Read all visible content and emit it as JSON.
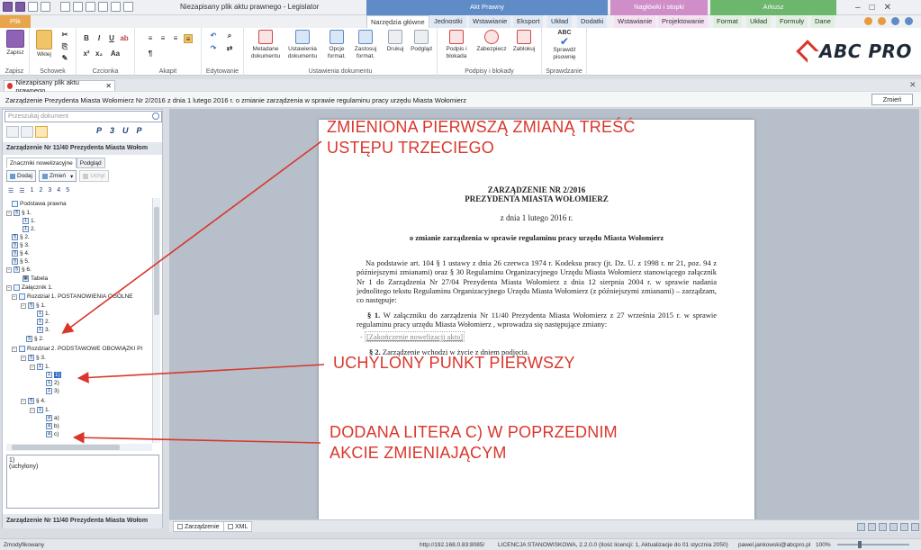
{
  "window": {
    "title": "Niezapisany plik aktu prawnego - Legislator"
  },
  "context_tabs": {
    "akt": "Akt Prawny",
    "naglowki": "Nagłówki i stopki",
    "arkusz": "Arkusz"
  },
  "tabs": {
    "plik": "Plik",
    "narzedzia": "Narzędzia główne",
    "jednostki": "Jednostki",
    "wstawianie": "Wstawianie",
    "eksport": "Eksport",
    "uklad": "Układ",
    "dodatki": "Dodatki",
    "hf_wstawianie": "Wstawianie",
    "projektowanie": "Projektowanie",
    "format": "Format",
    "ark_uklad": "Układ",
    "formuly": "Formuły",
    "dane": "Dane"
  },
  "ribbon": {
    "zapisz": "Zapisz",
    "wklej": "Wklej",
    "metadane": "Metadane dokumentu",
    "ustawienia": "Ustawienia dokumentu",
    "opcje": "Opcje format.",
    "zastosuj": "Zastosuj format.",
    "drukuj": "Drukuj",
    "podglad": "Podgląd",
    "podpis": "Podpis i blokada",
    "zabezpiecz": "Zabezpiecz",
    "zablokuj": "Zablokuj",
    "sprawdz": "Sprawdź pisownię",
    "abc": "ABC",
    "groups": {
      "zapisz": "Zapisz",
      "schowek": "Schowek",
      "czcionka": "Czcionka",
      "akapit": "Akapit",
      "edytowanie": "Edytowanie",
      "ustawienia": "Ustawienia dokumentu",
      "podpisy": "Podpisy i blokady",
      "sprawdzanie": "Sprawdzanie"
    }
  },
  "logo": {
    "text": "ABC PRO"
  },
  "doc_tab": {
    "label": "Niezapisany plik aktu prawnego"
  },
  "subtitle": {
    "text": "Zarządzenie Prezydenta Miasta Wołomierz Nr 2/2016 z dnia 1 lutego 2016 r. o zmianie zarządzenia w sprawie regulaminu pracy urzędu Miasta Wołomierz",
    "button": "Zmień"
  },
  "left": {
    "search_placeholder": "Przeszukaj dokument",
    "heading": "Zarządzenie Nr 11/40 Prezydenta Miasta Wołom",
    "tab_znaczniki": "Znaczniki nowelizacyjne",
    "tab_podglad": "Podgląd",
    "btn_dodaj": "Dodaj",
    "btn_zmien": "Zmień",
    "btn_uchyl": "Uchyl",
    "levels": [
      "1",
      "2",
      "3",
      "4",
      "5"
    ],
    "tree": [
      "Podstawa prawna",
      "§ 1.",
      "1.",
      "2.",
      "§ 2.",
      "§ 3.",
      "§ 4.",
      "§ 5.",
      "§ 6.",
      "Tabela",
      "Załącznik 1.",
      "Rozdział 1. POSTANOWIENIA OGÓLNE",
      "§ 1.",
      "1.",
      "2.",
      "3.",
      "§ 2.",
      "Rozdział 2. PODSTAWOWE OBOWIĄZKI PI",
      "§ 3.",
      "1.",
      "1)",
      "2)",
      "3)",
      "§ 4.",
      "1.",
      "a)",
      "b)",
      "c)"
    ],
    "detail_line1": "1)",
    "detail_line2": "(uchylony)",
    "footer": "Zarządzenie Nr 11/40 Prezydenta Miasta Wołom"
  },
  "document": {
    "title1": "ZARZĄDZENIE NR 2/2016",
    "title2": "PREZYDENTA MIASTA WOŁOMIERZ",
    "date": "z dnia 1 lutego 2016 r.",
    "subject": "o zmianie zarządzenia w sprawie regulaminu pracy urzędu Miasta Wołomierz",
    "body": "Na podstawie art. 104 § 1 ustawy z dnia 26 czerwca 1974 r. Kodeksu pracy (jt. Dz. U. z 1998 r. nr 21, poz. 94 z późniejszymi zmianami) oraz § 30 Regulaminu Organizacyjnego Urzędu Miasta Wołomierz stanowiącego załącznik Nr 1 do Zarządzenia Nr 27/04 Prezydenta Miasta Wołomierz z dnia 12 sierpnia 2004 r. w sprawie nadania jednolitego tekstu Regulaminu Organizacyjnego Urzędu Miasta Wołomierz (z późniejszymi zmianami) – zarządzam, co następuje:",
    "par1_num": "§ 1.",
    "par1_text": " W załączniku do zarządzenia Nr 11/40 Prezydenta Miasta Wołomierz z 27 września 2015 r. w sprawie regulaminu pracy urzędu Miasta Wołomierz , wprowadza się następujące zmiany:",
    "bullet": "[Zakończenie nowelizacji aktu]",
    "par2_num": "§ 2.",
    "par2_text": " Zarządzenie wchodzi w życie z dniem podjęcia."
  },
  "annotations": {
    "a1_line1": "ZMIENIONA PIERWSZĄ ZMIANĄ TREŚĆ",
    "a1_line2": "USTĘPU TRZECIEGO",
    "a2": "UCHYLONY PUNKT PIERWSZY",
    "a3_line1": "DODANA LITERA C) W POPRZEDNIM",
    "a3_line2": "AKCIE ZMIENIAJĄCYM"
  },
  "bottom_tabs": {
    "zarzadzenie": "Zarządzenie",
    "xml": "XML"
  },
  "status": {
    "left": "Zmodyfikowany",
    "server": "http://192.168.0.83:8085/",
    "license": "LICENCJA STANOWISKOWA, 2.2.0.0 (Ilość licencji: 1, Aktualizacje do 01 stycznia 2050)",
    "user": "pawel.jankowski@abcpro.pl",
    "zoom": "100%"
  },
  "colors": {
    "annotation": "#d9362b",
    "selection": "#2b6cc4",
    "plik": "#e9a54b"
  }
}
